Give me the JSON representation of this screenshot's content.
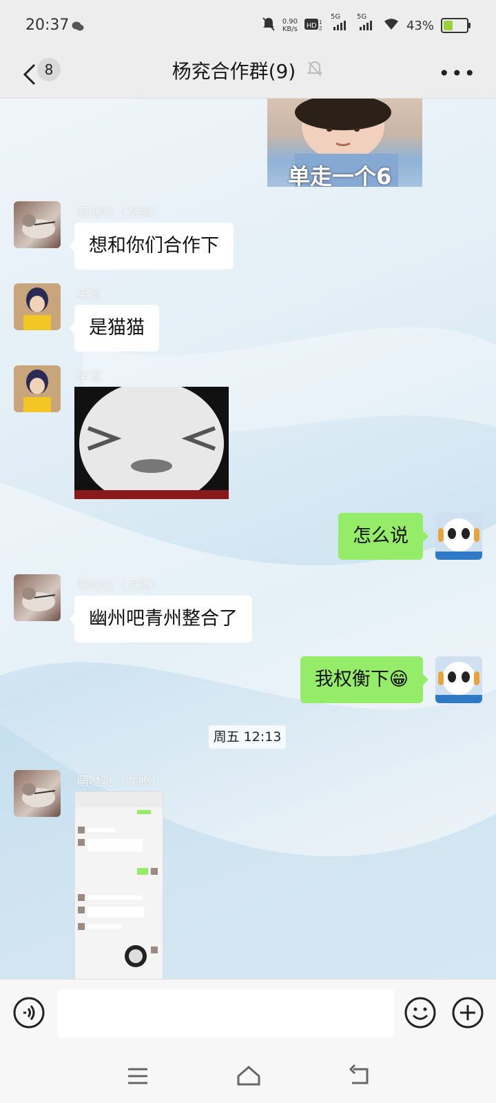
{
  "status_bar": {
    "time": "20:37",
    "net_speed_value": "0.90",
    "net_speed_unit": "KB/s",
    "battery_percent": "43%",
    "battery_level": 0.43,
    "network_1": "5G",
    "network_2": "5G"
  },
  "nav": {
    "unread_count": "8",
    "title": "杨兖合作群(9)"
  },
  "messages": [
    {
      "type": "image",
      "side": "right",
      "caption": "单走一个6"
    },
    {
      "type": "text",
      "side": "left",
      "sender": "萌哒哒（龙腾）",
      "text": "想和你们合作下"
    },
    {
      "type": "text",
      "side": "left",
      "sender": "枭鸾",
      "text": "是猫猫"
    },
    {
      "type": "image",
      "side": "left",
      "sender": "枭鸾"
    },
    {
      "type": "text",
      "side": "right",
      "text": "怎么说"
    },
    {
      "type": "text",
      "side": "left",
      "sender": "萌哒哒（龙腾）",
      "text": "幽州吧青州整合了"
    },
    {
      "type": "text",
      "side": "right",
      "text": "我权衡下😁"
    },
    {
      "type": "timestamp",
      "text": "周五 12:13"
    },
    {
      "type": "image",
      "side": "left",
      "sender": "萌哒哒（龙腾）"
    }
  ],
  "input": {
    "placeholder": ""
  },
  "icons": [
    "back-icon",
    "mute-icon",
    "more-icon",
    "voice-icon",
    "emoji-icon",
    "plus-icon",
    "menu-icon",
    "home-icon",
    "back-nav-icon"
  ],
  "colors": {
    "bubble_self": "#95ec69",
    "bubble_other": "#ffffff",
    "bar": "#ededed"
  }
}
